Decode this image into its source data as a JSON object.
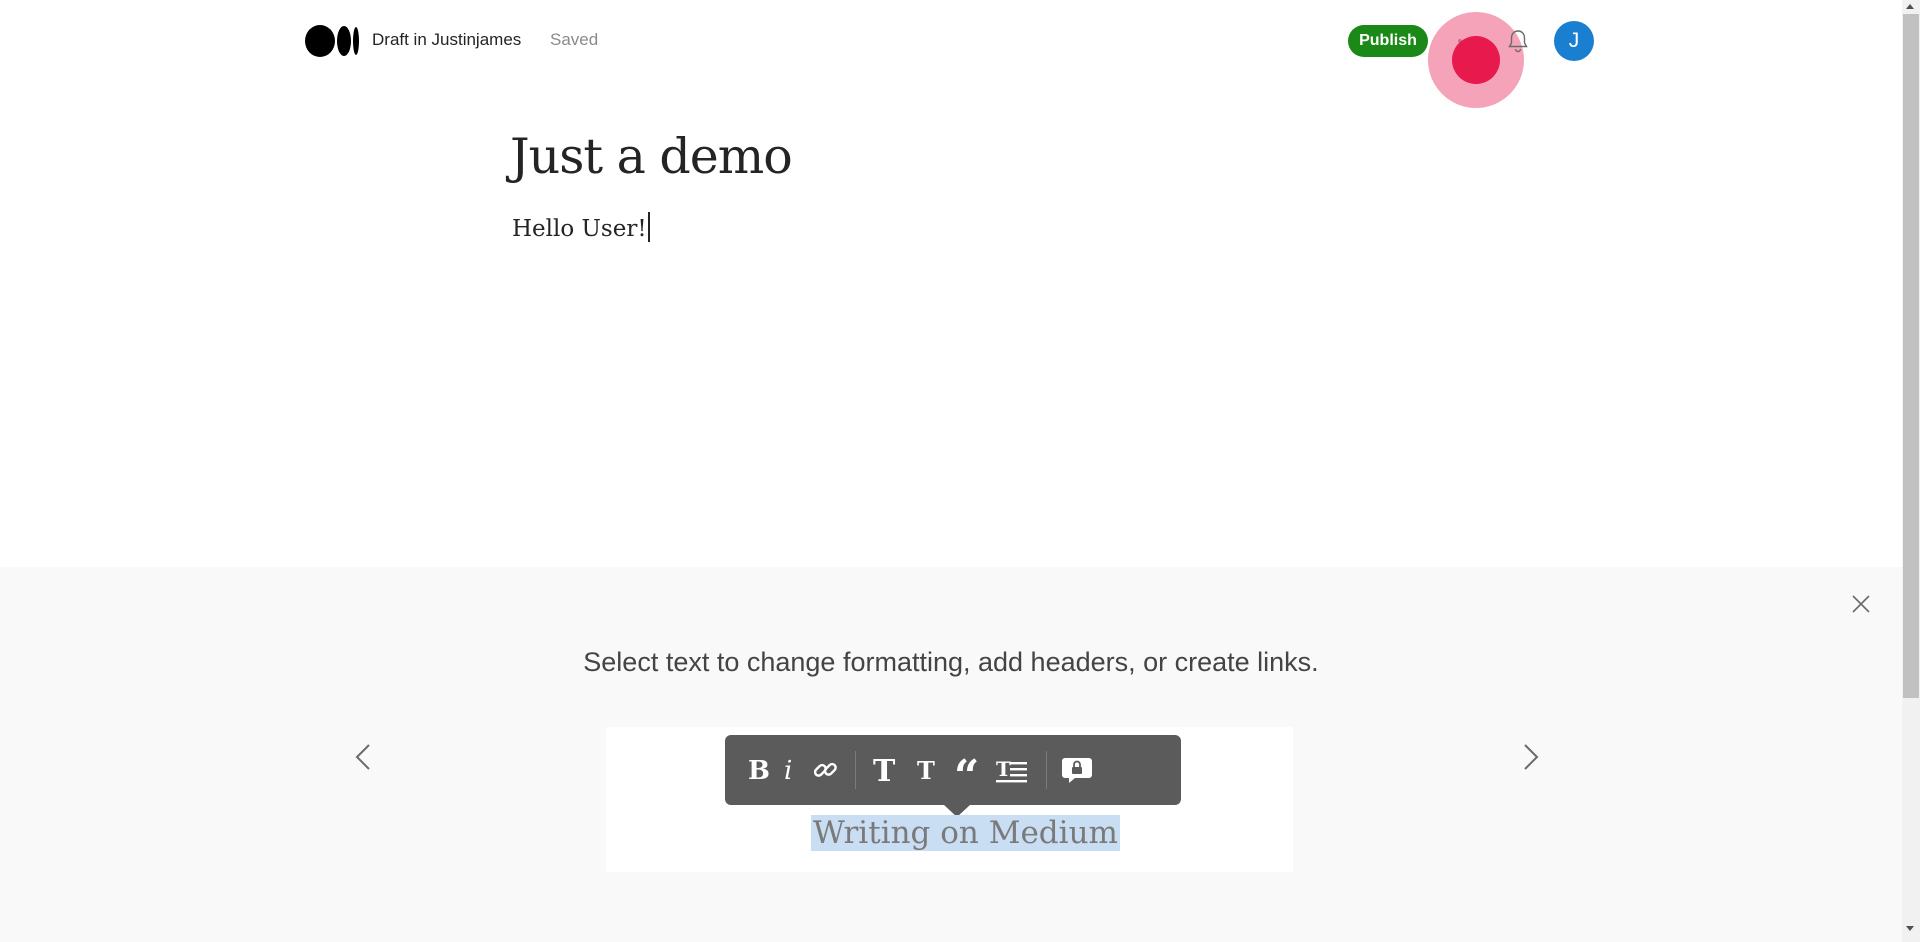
{
  "header": {
    "draft_label": "Draft in Justinjames",
    "saved_label": "Saved",
    "publish_label": "Publish",
    "avatar_initial": "J",
    "colors": {
      "publish": "#1a8917",
      "avatar": "#1a7fd1"
    }
  },
  "story": {
    "title": "Just a demo",
    "body": "Hello User!"
  },
  "tips": {
    "message": "Select text to change formatting, add headers, or create links.",
    "demo_text": "Writing on Medium",
    "toolbar_items": [
      "bold-icon",
      "italic-icon",
      "link-icon",
      "large-title-icon",
      "small-title-icon",
      "quote-icon",
      "drop-cap-icon",
      "private-note-icon"
    ]
  },
  "icons": [
    "medium-logo-icon",
    "more-icon",
    "bell-icon",
    "close-icon",
    "chevron-left-icon",
    "chevron-right-icon"
  ]
}
